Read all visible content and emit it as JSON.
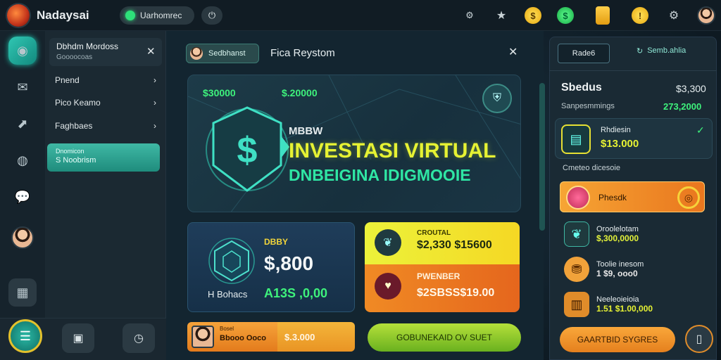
{
  "app": {
    "name": "Nadaysai"
  },
  "topbar": {
    "pill_label": "Uarhomrec",
    "icons": [
      "settings-gear-icon",
      "star-icon",
      "gold-coin-icon",
      "green-coin-icon",
      "wallet-card-icon",
      "notification-coin-icon",
      "gear-icon",
      "profile-avatar"
    ]
  },
  "sidebar": {
    "header": {
      "title": "Dbhdm Mordoss",
      "subtitle": "Goooocoas"
    },
    "items": [
      {
        "label": "Pnend"
      },
      {
        "label": "Pico Keamo"
      },
      {
        "label": "Faghbaes"
      }
    ],
    "active": {
      "title": "Dnomicon",
      "label": "S Noobrism"
    }
  },
  "modal": {
    "badge_label": "Sedbhanst",
    "title": "Fica Reystom",
    "hero": {
      "amount_left": "$30000",
      "amount_right": "$.20000",
      "line1": "MBBW",
      "line2": "INVESTASI VIRTUAL",
      "line3": "DNBEIGINA IDIGMOOIE"
    },
    "card_blue": {
      "tag": "DBBY",
      "amount": "$,800",
      "caption": "H Bohacs",
      "caption_amount": "A13S ,0,00"
    },
    "card_yellow": {
      "tag": "CROUTAL",
      "amount": "$2,330 $15600"
    },
    "card_orange": {
      "tag": "PWENBER",
      "amount": "$2SBSS$19.00"
    },
    "strip": {
      "label_small": "Bosel",
      "label": "Bbooo Ooco",
      "amount": "$.3.000"
    },
    "action_button": "GOBUNEKAID OV SUET"
  },
  "rpanel": {
    "tab1": "Rade6",
    "tab2": "Semb.ahlia",
    "title": "Sbedus",
    "title_amount": "$3,300",
    "sub_label": "Sanpesmmings",
    "sub_amount": "273,2000",
    "featured": {
      "label": "Rhdiesin",
      "amount": "$13.000"
    },
    "section_label": "Cmeteo dicesoie",
    "highlight_label": "Phesdk",
    "rows": [
      {
        "label": "Oroolelotam",
        "amount": "$,300,0000"
      },
      {
        "label": "Toolie inesom",
        "amount": "1 $9, ooo0"
      },
      {
        "label": "Neeleoieioia",
        "amount": "1.51 $1.00,000"
      }
    ],
    "bottom_button": "GAARTBID SYGRES"
  },
  "colors": {
    "accent_teal": "#2fc4ae",
    "accent_green": "#3ef27c",
    "accent_yellow": "#e6f233",
    "accent_orange": "#f0861f"
  }
}
